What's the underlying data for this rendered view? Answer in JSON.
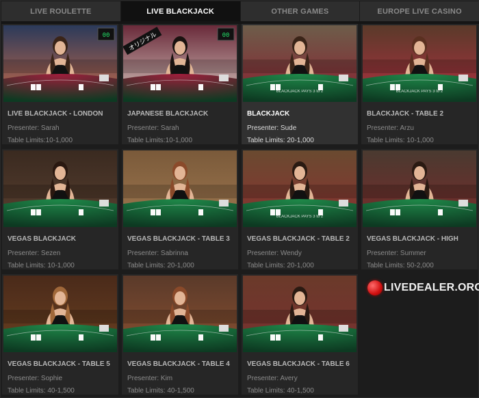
{
  "tabs": [
    {
      "label": "LIVE ROULETTE",
      "active": false
    },
    {
      "label": "LIVE BLACKJACK",
      "active": true
    },
    {
      "label": "OTHER GAMES",
      "active": false
    },
    {
      "label": "EUROPE LIVE CASINO",
      "active": false
    }
  ],
  "cards": [
    {
      "title": "LIVE BLACKJACK - LONDON",
      "presenter": "Presenter: Sarah",
      "limits": "Table Limits:10-1,000"
    },
    {
      "title": "JAPANESE BLACKJACK",
      "presenter": "Presenter: Sarah",
      "limits": "Table Limits:10-1,000",
      "badge": "オリジナル"
    },
    {
      "title": "BLACKJACK",
      "presenter": "Presenter: Sude",
      "limits": "Table Limits: 20-1,000",
      "highlight": true,
      "table_text": "BLACKJACK PAYS 3 to 2"
    },
    {
      "title": "BLACKJACK - TABLE 2",
      "presenter": "Presenter: Arzu",
      "limits": "Table Limits: 10-1,000",
      "table_text": "BLACKJACK PAYS 3 to 2"
    },
    {
      "title": "VEGAS BLACKJACK",
      "presenter": "Presenter: Sezen",
      "limits": "Table Limits: 10-1,000"
    },
    {
      "title": "VEGAS BLACKJACK - TABLE 3",
      "presenter": "Presenter: Sabrinna",
      "limits": "Table Limits: 20-1,000"
    },
    {
      "title": "VEGAS BLACKJACK - TABLE 2",
      "presenter": "Presenter: Wendy",
      "limits": "Table Limits: 20-1,000",
      "table_text": "BLACKJACK PAYS 3 to 2"
    },
    {
      "title": "VEGAS BLACKJACK - HIGH",
      "presenter": "Presenter: Summer",
      "limits": "Table Limits: 50-2,000"
    },
    {
      "title": "VEGAS BLACKJACK - TABLE 5",
      "presenter": "Presenter: Sophie",
      "limits": "Table Limits: 40-1,500"
    },
    {
      "title": "VEGAS BLACKJACK - TABLE 4",
      "presenter": "Presenter: Kim",
      "limits": "Table Limits: 40-1,500"
    },
    {
      "title": "VEGAS BLACKJACK - TABLE 6",
      "presenter": "Presenter: Avery",
      "limits": "Table Limits: 40-1,500"
    }
  ],
  "logo": {
    "text": "LIVEDEALER.ORG"
  },
  "colors": {
    "felt_green": "#1f8a4a",
    "felt_red": "#a01e3c",
    "accent_red": "#d01010"
  }
}
